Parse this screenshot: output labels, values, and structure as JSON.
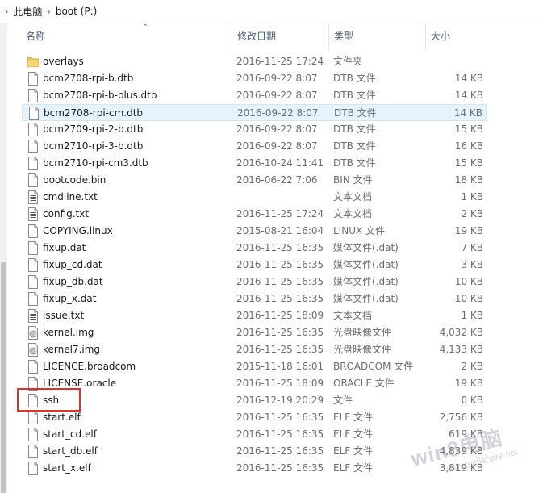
{
  "breadcrumb": {
    "items": [
      "此电脑",
      "boot (P:)"
    ]
  },
  "columns": {
    "name": "名称",
    "date": "修改日期",
    "type": "类型",
    "size": "大小"
  },
  "files": [
    {
      "name": "overlays",
      "date": "2016-11-25 17:24",
      "type": "文件夹",
      "size": "",
      "icon": "folder-icon"
    },
    {
      "name": "bcm2708-rpi-b.dtb",
      "date": "2016-09-22 8:07",
      "type": "DTB 文件",
      "size": "14 KB",
      "icon": "file-icon"
    },
    {
      "name": "bcm2708-rpi-b-plus.dtb",
      "date": "2016-09-22 8:07",
      "type": "DTB 文件",
      "size": "14 KB",
      "icon": "file-icon"
    },
    {
      "name": "bcm2708-rpi-cm.dtb",
      "date": "2016-09-22 8:07",
      "type": "DTB 文件",
      "size": "14 KB",
      "icon": "file-icon",
      "selected": true
    },
    {
      "name": "bcm2709-rpi-2-b.dtb",
      "date": "2016-09-22 8:07",
      "type": "DTB 文件",
      "size": "15 KB",
      "icon": "file-icon"
    },
    {
      "name": "bcm2710-rpi-3-b.dtb",
      "date": "2016-09-22 8:07",
      "type": "DTB 文件",
      "size": "16 KB",
      "icon": "file-icon"
    },
    {
      "name": "bcm2710-rpi-cm3.dtb",
      "date": "2016-10-24 11:41",
      "type": "DTB 文件",
      "size": "15 KB",
      "icon": "file-icon"
    },
    {
      "name": "bootcode.bin",
      "date": "2016-06-22 7:06",
      "type": "BIN 文件",
      "size": "18 KB",
      "icon": "file-icon"
    },
    {
      "name": "cmdline.txt",
      "date": "",
      "type": "文本文档",
      "size": "1 KB",
      "icon": "text-file-icon"
    },
    {
      "name": "config.txt",
      "date": "2016-11-25 17:24",
      "type": "文本文档",
      "size": "2 KB",
      "icon": "text-file-icon"
    },
    {
      "name": "COPYING.linux",
      "date": "2015-08-21 16:04",
      "type": "LINUX 文件",
      "size": "19 KB",
      "icon": "file-icon"
    },
    {
      "name": "fixup.dat",
      "date": "2016-11-25 16:35",
      "type": "媒体文件(.dat)",
      "size": "7 KB",
      "icon": "file-icon"
    },
    {
      "name": "fixup_cd.dat",
      "date": "2016-11-25 16:35",
      "type": "媒体文件(.dat)",
      "size": "3 KB",
      "icon": "file-icon"
    },
    {
      "name": "fixup_db.dat",
      "date": "2016-11-25 16:35",
      "type": "媒体文件(.dat)",
      "size": "10 KB",
      "icon": "file-icon"
    },
    {
      "name": "fixup_x.dat",
      "date": "2016-11-25 16:35",
      "type": "媒体文件(.dat)",
      "size": "10 KB",
      "icon": "file-icon"
    },
    {
      "name": "issue.txt",
      "date": "2016-11-25 18:09",
      "type": "文本文档",
      "size": "1 KB",
      "icon": "text-file-icon"
    },
    {
      "name": "kernel.img",
      "date": "2016-11-25 16:35",
      "type": "光盘映像文件",
      "size": "4,032 KB",
      "icon": "disc-image-icon"
    },
    {
      "name": "kernel7.img",
      "date": "2016-11-25 16:35",
      "type": "光盘映像文件",
      "size": "4,133 KB",
      "icon": "disc-image-icon"
    },
    {
      "name": "LICENCE.broadcom",
      "date": "2015-11-18 16:01",
      "type": "BROADCOM 文件",
      "size": "2 KB",
      "icon": "file-icon"
    },
    {
      "name": "LICENSE.oracle",
      "date": "2016-11-25 18:09",
      "type": "ORACLE 文件",
      "size": "19 KB",
      "icon": "file-icon"
    },
    {
      "name": "ssh",
      "date": "2016-12-19 20:29",
      "type": "文件",
      "size": "0 KB",
      "icon": "file-icon"
    },
    {
      "name": "start.elf",
      "date": "2016-11-25 16:35",
      "type": "ELF 文件",
      "size": "2,756 KB",
      "icon": "file-icon"
    },
    {
      "name": "start_cd.elf",
      "date": "2016-11-25 16:35",
      "type": "ELF 文件",
      "size": "619 KB",
      "icon": "file-icon"
    },
    {
      "name": "start_db.elf",
      "date": "2016-11-25 16:35",
      "type": "ELF 文件",
      "size": "4,839 KB",
      "icon": "file-icon"
    },
    {
      "name": "start_x.elf",
      "date": "2016-11-25 16:35",
      "type": "ELF 文件",
      "size": "3,819 KB",
      "icon": "file-icon"
    }
  ],
  "watermark": {
    "line1": "win8电脑",
    "line2": "www.pc6share.net"
  },
  "colors": {
    "selection": "#e5f3ff",
    "annotation_box": "#e0302c",
    "folder": "#f0c75e"
  }
}
